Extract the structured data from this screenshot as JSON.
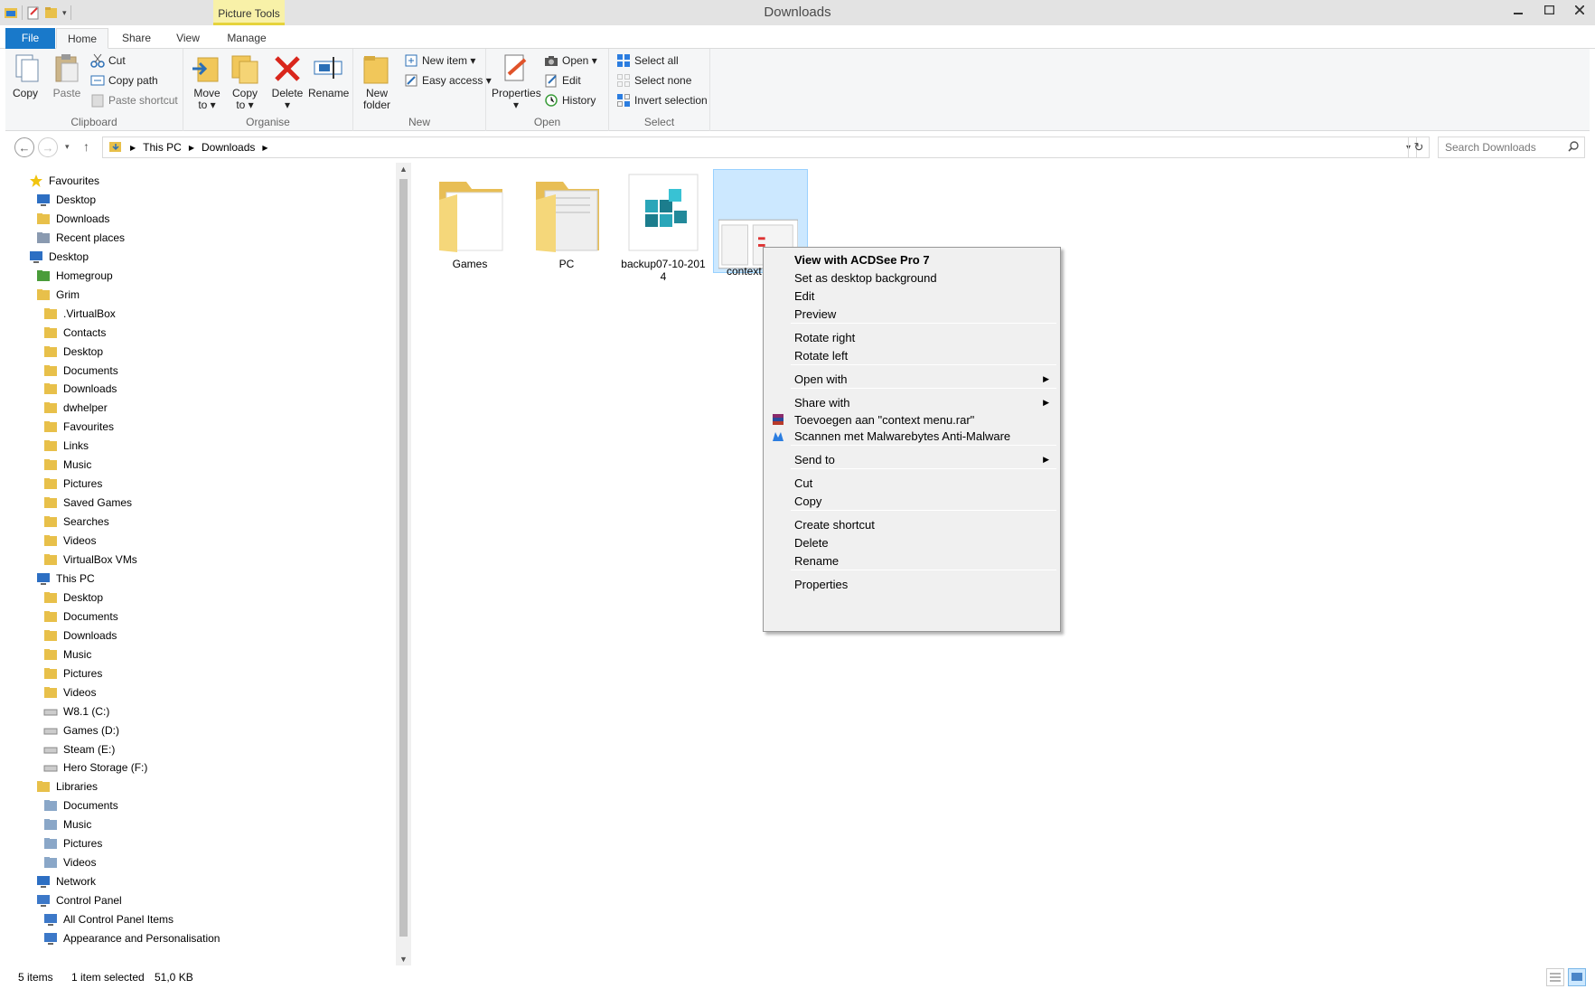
{
  "window": {
    "title": "Downloads",
    "context_tab": "Picture Tools"
  },
  "tabs": [
    "File",
    "Home",
    "Share",
    "View",
    "Manage"
  ],
  "ribbon": {
    "clipboard": {
      "label": "Clipboard",
      "copy": "Copy",
      "paste": "Paste",
      "cut": "Cut",
      "copy_path": "Copy path",
      "paste_shortcut": "Paste shortcut"
    },
    "organise": {
      "label": "Organise",
      "move_to_1": "Move",
      "move_to_2": "to ▾",
      "copy_to_1": "Copy",
      "copy_to_2": "to ▾",
      "delete_1": "Delete",
      "delete_2": "▾",
      "rename": "Rename"
    },
    "new": {
      "label": "New",
      "new_folder_1": "New",
      "new_folder_2": "folder",
      "new_item": "New item ▾",
      "easy_access": "Easy access ▾"
    },
    "open": {
      "label": "Open",
      "properties_1": "Properties",
      "properties_2": "▾",
      "open": "Open ▾",
      "edit": "Edit",
      "history": "History"
    },
    "select": {
      "label": "Select",
      "select_all": "Select all",
      "select_none": "Select none",
      "invert_selection": "Invert selection"
    }
  },
  "address": {
    "crumbs": [
      "This PC",
      "Downloads"
    ],
    "search_placeholder": "Search Downloads"
  },
  "nav": {
    "items": [
      {
        "label": "Favourites",
        "icon": "star-icon"
      },
      {
        "label": "Desktop",
        "icon": "desktop-icon"
      },
      {
        "label": "Downloads",
        "icon": "downloads-folder-icon"
      },
      {
        "label": "Recent places",
        "icon": "recent-places-icon"
      },
      {
        "label": "Desktop",
        "icon": "desktop-icon"
      },
      {
        "label": "Homegroup",
        "icon": "homegroup-icon"
      },
      {
        "label": "Grim",
        "icon": "user-folder-icon"
      },
      {
        "label": ".VirtualBox",
        "icon": "folder-icon"
      },
      {
        "label": "Contacts",
        "icon": "folder-icon"
      },
      {
        "label": "Desktop",
        "icon": "folder-icon"
      },
      {
        "label": "Documents",
        "icon": "folder-icon"
      },
      {
        "label": "Downloads",
        "icon": "folder-icon"
      },
      {
        "label": "dwhelper",
        "icon": "folder-icon"
      },
      {
        "label": "Favourites",
        "icon": "folder-icon"
      },
      {
        "label": "Links",
        "icon": "folder-icon"
      },
      {
        "label": "Music",
        "icon": "folder-icon"
      },
      {
        "label": "Pictures",
        "icon": "folder-icon"
      },
      {
        "label": "Saved Games",
        "icon": "folder-icon"
      },
      {
        "label": "Searches",
        "icon": "folder-icon"
      },
      {
        "label": "Videos",
        "icon": "folder-icon"
      },
      {
        "label": "VirtualBox VMs",
        "icon": "folder-icon"
      },
      {
        "label": "This PC",
        "icon": "computer-icon"
      },
      {
        "label": "Desktop",
        "icon": "folder-icon"
      },
      {
        "label": "Documents",
        "icon": "folder-icon"
      },
      {
        "label": "Downloads",
        "icon": "folder-icon"
      },
      {
        "label": "Music",
        "icon": "folder-icon"
      },
      {
        "label": "Pictures",
        "icon": "folder-icon"
      },
      {
        "label": "Videos",
        "icon": "folder-icon"
      },
      {
        "label": "W8.1 (C:)",
        "icon": "drive-icon"
      },
      {
        "label": "Games (D:)",
        "icon": "drive-icon"
      },
      {
        "label": "Steam (E:)",
        "icon": "drive-icon"
      },
      {
        "label": "Hero Storage (F:)",
        "icon": "drive-icon"
      },
      {
        "label": "Libraries",
        "icon": "libraries-icon"
      },
      {
        "label": "Documents",
        "icon": "library-icon"
      },
      {
        "label": "Music",
        "icon": "library-icon"
      },
      {
        "label": "Pictures",
        "icon": "library-icon"
      },
      {
        "label": "Videos",
        "icon": "library-icon"
      },
      {
        "label": "Network",
        "icon": "network-icon"
      },
      {
        "label": "Control Panel",
        "icon": "control-panel-icon"
      },
      {
        "label": "All Control Panel Items",
        "icon": "control-panel-icon"
      },
      {
        "label": "Appearance and Personalisation",
        "icon": "control-panel-icon"
      }
    ],
    "selected_index": 24
  },
  "files": [
    {
      "name": "Games",
      "type": "folder"
    },
    {
      "name": "PC",
      "type": "folder"
    },
    {
      "name_line1": "backup07-10-201",
      "name_line2": "4",
      "type": "reg"
    },
    {
      "name": "context",
      "type": "image",
      "selected": true
    }
  ],
  "context_menu": {
    "items": [
      {
        "label": "View with ACDSee Pro 7",
        "bold": true
      },
      {
        "label": "Set as desktop background"
      },
      {
        "label": "Edit"
      },
      {
        "label": "Preview"
      },
      {
        "label": "Rotate right"
      },
      {
        "label": "Rotate left"
      },
      {
        "label": "Open with",
        "submenu": true
      },
      {
        "label": "Share with",
        "submenu": true
      },
      {
        "label": "Toevoegen aan \"context menu.rar\"",
        "icon": "winrar-icon"
      },
      {
        "label": "Scannen met Malwarebytes Anti-Malware",
        "icon": "malwarebytes-icon"
      },
      {
        "label": "Send to",
        "submenu": true
      },
      {
        "label": "Cut"
      },
      {
        "label": "Copy"
      },
      {
        "label": "Create shortcut"
      },
      {
        "label": "Delete"
      },
      {
        "label": "Rename"
      },
      {
        "label": "Properties"
      }
    ]
  },
  "status": {
    "item_count": "5 items",
    "selection": "1 item selected",
    "size": "51,0 KB"
  },
  "colors": {
    "file_tab": "#1979ca",
    "selection": "#cce8ff",
    "picture_tools": "#f8f1a8"
  }
}
